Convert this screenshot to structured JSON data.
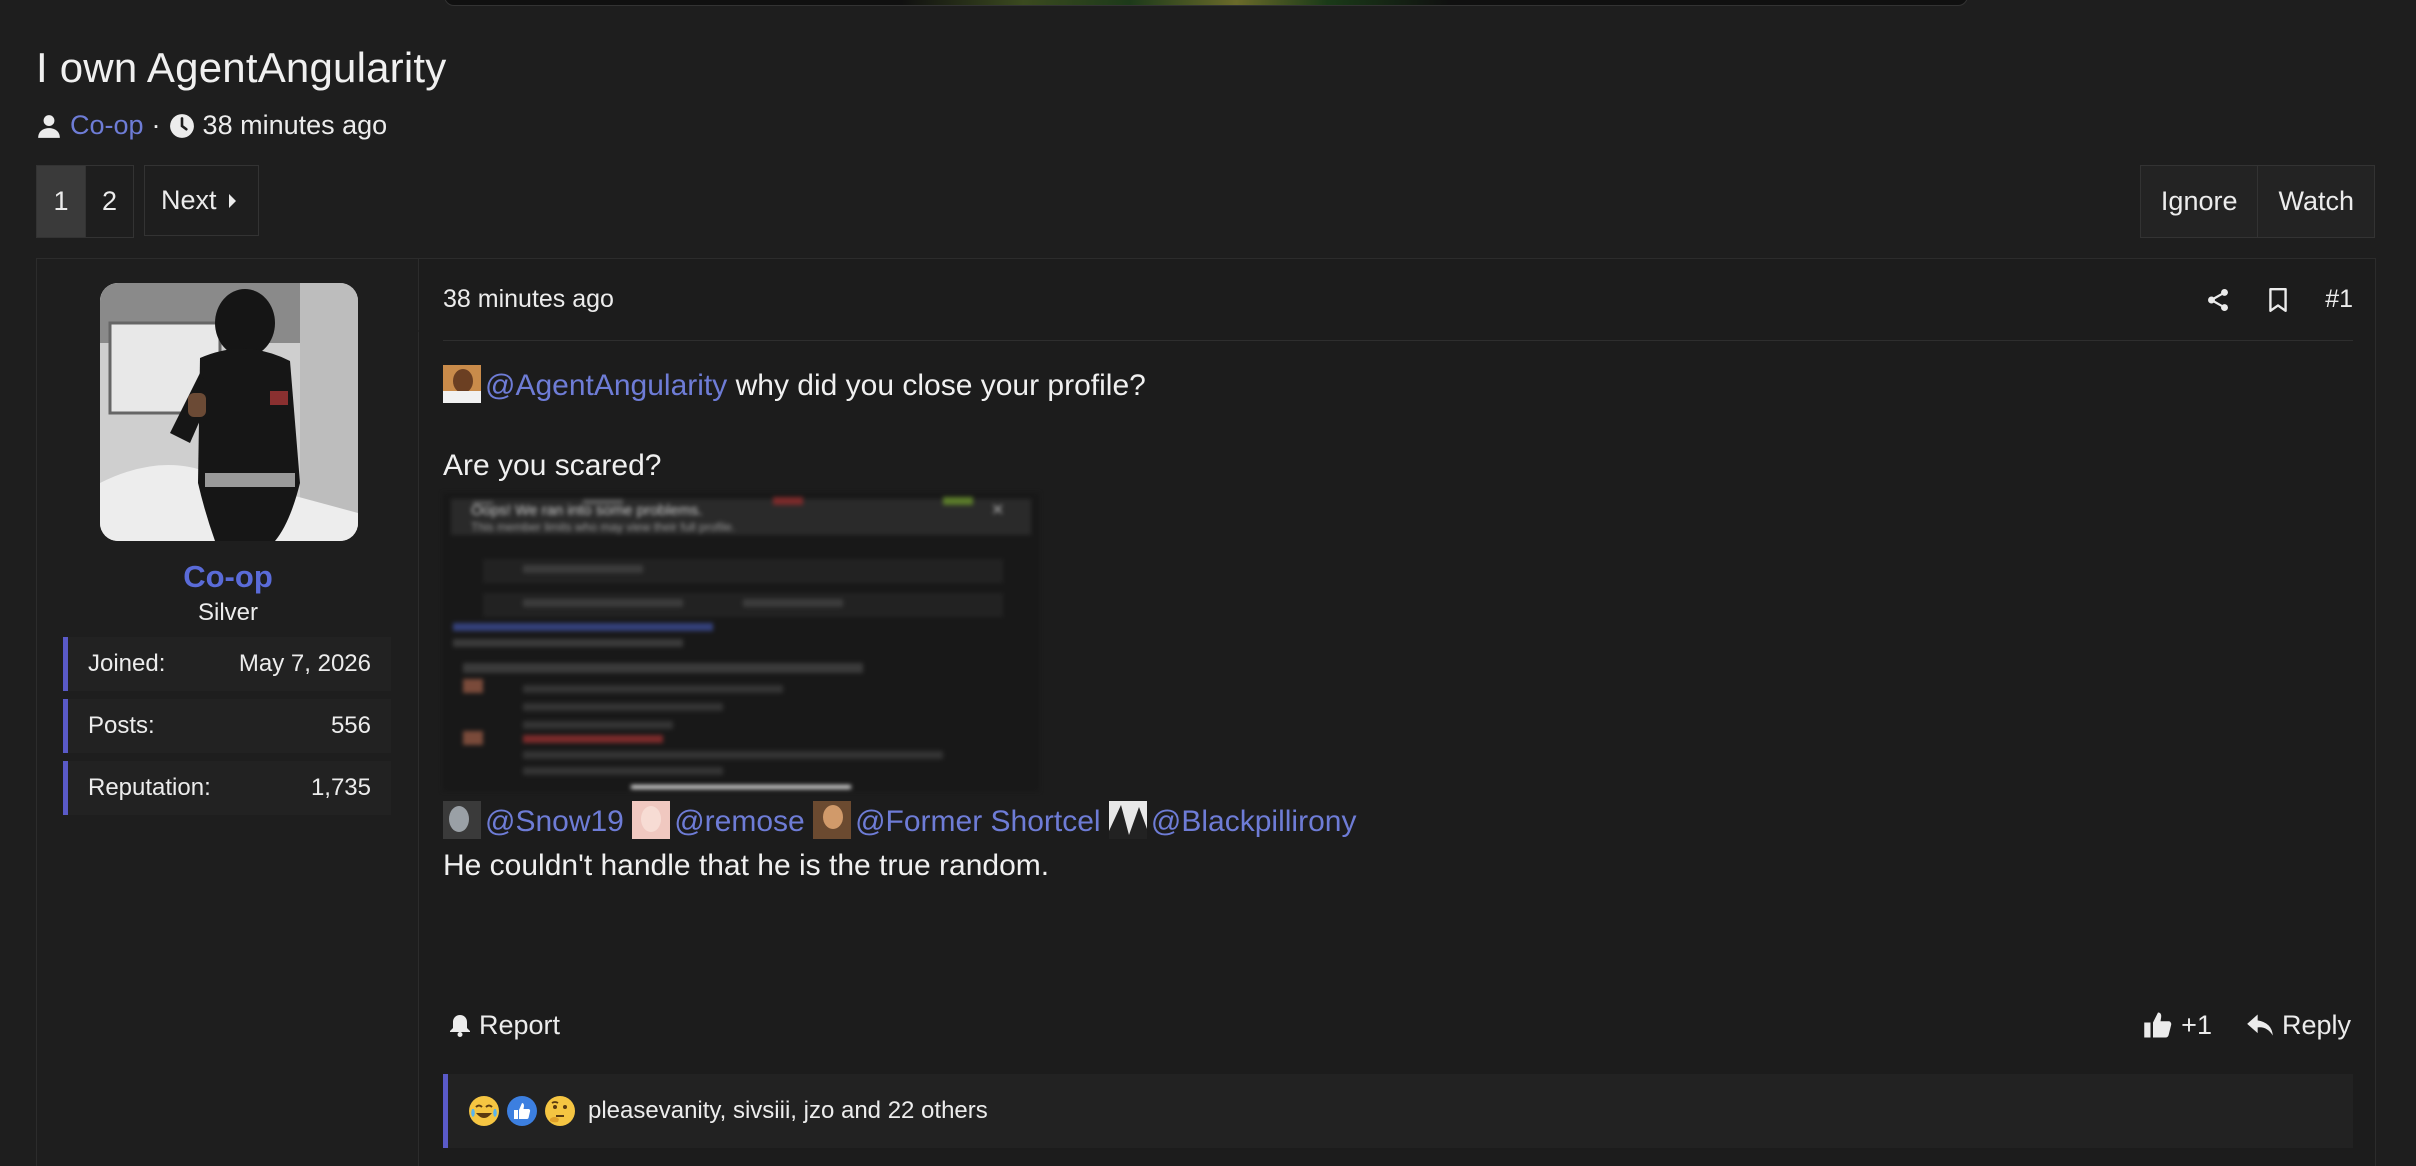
{
  "thread": {
    "title": "I own AgentAngularity",
    "author": "Co-op",
    "separator": "·",
    "time": "38 minutes ago"
  },
  "pagination": {
    "pages": [
      "1",
      "2"
    ],
    "active_page": "1",
    "next_label": "Next"
  },
  "thread_actions": {
    "ignore_label": "Ignore",
    "watch_label": "Watch"
  },
  "user": {
    "name": "Co-op",
    "title": "Silver",
    "stats": [
      {
        "label": "Joined:",
        "value": "May 7, 2026"
      },
      {
        "label": "Posts:",
        "value": "556"
      },
      {
        "label": "Reputation:",
        "value": "1,735"
      }
    ]
  },
  "post": {
    "time": "38 minutes ago",
    "number": "#1",
    "line1_mention": "@AgentAngularity",
    "line1_text": " why did you close your profile?",
    "line2": "Are you scared?",
    "screenshot_title": "Oops! We ran into some problems.",
    "screenshot_subtitle": "This member limits who may view their full profile.",
    "mentions": [
      "@Snow19",
      "@remose",
      "@Former Shortcel",
      "@Blackpillirony"
    ],
    "line3": "He couldn't handle that he is the true random."
  },
  "footer": {
    "report_label": "Report",
    "like_count": "+1",
    "reply_label": "Reply"
  },
  "reactions": {
    "summary": "pleasevanity, sivsiii, jzo and 22 others",
    "icons": [
      "crying-laughing-emoji",
      "thumbs-up-emoji",
      "thinking-emoji"
    ]
  },
  "colors": {
    "background": "#1e1e1e",
    "link": "#6e7cd6",
    "accent": "#5a5ac8",
    "username": "#5a6bd8"
  }
}
